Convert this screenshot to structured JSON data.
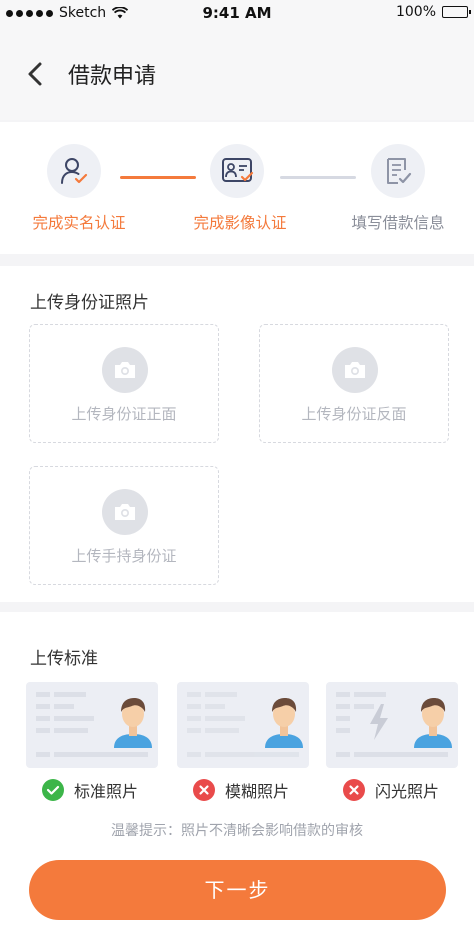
{
  "status_bar": {
    "carrier": "Sketch",
    "time": "9:41 AM",
    "battery": "100%"
  },
  "nav": {
    "title": "借款申请"
  },
  "steps": [
    {
      "label": "完成实名认证",
      "state": "done"
    },
    {
      "label": "完成影像认证",
      "state": "done"
    },
    {
      "label": "填写借款信息",
      "state": "todo"
    }
  ],
  "upload": {
    "title": "上传身份证照片",
    "items": [
      {
        "label": "上传身份证正面"
      },
      {
        "label": "上传身份证反面"
      },
      {
        "label": "上传手持身份证"
      }
    ]
  },
  "standard": {
    "title": "上传标准",
    "samples": [
      {
        "label": "标准照片",
        "status": "ok"
      },
      {
        "label": "模糊照片",
        "status": "error"
      },
      {
        "label": "闪光照片",
        "status": "error"
      }
    ],
    "tip": "温馨提示：照片不清晰会影响借款的审核"
  },
  "actions": {
    "next_label": "下一步"
  },
  "colors": {
    "accent": "#f47a3c",
    "success": "#3cb549",
    "error": "#e94b4b"
  }
}
